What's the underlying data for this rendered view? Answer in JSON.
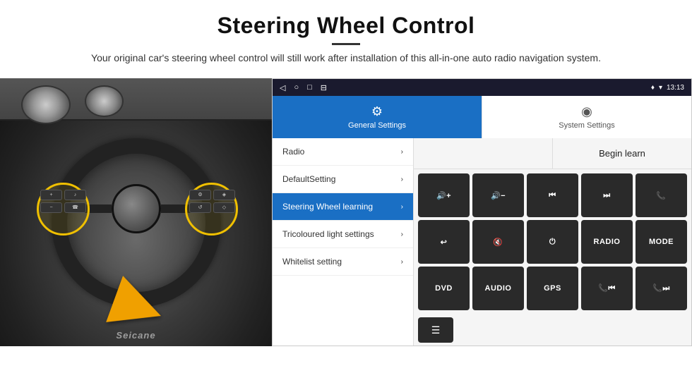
{
  "header": {
    "title": "Steering Wheel Control",
    "subtitle": "Your original car's steering wheel control will still work after installation of this all-in-one auto radio navigation system."
  },
  "status_bar": {
    "icons": [
      "◁",
      "○",
      "□",
      "⊟"
    ],
    "right_icons": [
      "♥",
      "▾"
    ],
    "time": "13:13"
  },
  "tabs": [
    {
      "id": "general",
      "icon": "⚙",
      "label": "General Settings",
      "active": true
    },
    {
      "id": "system",
      "icon": "◉",
      "label": "System Settings",
      "active": false
    }
  ],
  "menu_items": [
    {
      "label": "Radio",
      "active": false
    },
    {
      "label": "DefaultSetting",
      "active": false
    },
    {
      "label": "Steering Wheel learning",
      "active": true
    },
    {
      "label": "Tricoloured light settings",
      "active": false
    },
    {
      "label": "Whitelist setting",
      "active": false
    }
  ],
  "right_panel": {
    "begin_learn_label": "Begin learn",
    "buttons": [
      {
        "icon": "🔊+",
        "label": "vol-up"
      },
      {
        "icon": "🔊-",
        "label": "vol-down"
      },
      {
        "icon": "⏮",
        "label": "prev"
      },
      {
        "icon": "⏭",
        "label": "next"
      },
      {
        "icon": "📞",
        "label": "call"
      },
      {
        "icon": "↩",
        "label": "back"
      },
      {
        "icon": "🔇",
        "label": "mute"
      },
      {
        "icon": "⏻",
        "label": "power"
      },
      {
        "text": "RADIO",
        "label": "radio"
      },
      {
        "text": "MODE",
        "label": "mode"
      },
      {
        "text": "DVD",
        "label": "dvd"
      },
      {
        "text": "AUDIO",
        "label": "audio"
      },
      {
        "text": "GPS",
        "label": "gps"
      },
      {
        "icon": "📞⏮",
        "label": "call-prev"
      },
      {
        "icon": "📞⏭",
        "label": "call-next"
      }
    ],
    "bottom_icon": "☰"
  },
  "watermark": "Seicane",
  "sw_buttons_left": [
    "+",
    "🎵",
    "-",
    "📞"
  ],
  "sw_buttons_right": [
    "⚙",
    "◈",
    "🔄",
    "◇"
  ]
}
